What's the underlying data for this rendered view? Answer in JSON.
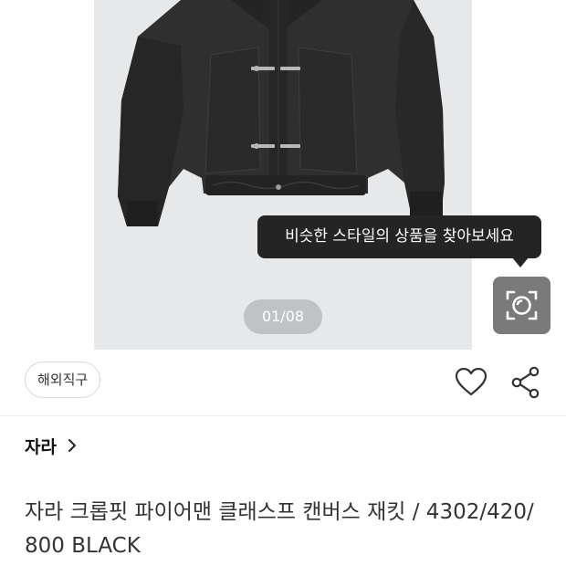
{
  "gallery": {
    "counter": "01/08",
    "visual_search_tooltip": "비슷한 스타일의 상품을 찾아보세요"
  },
  "product": {
    "badge": "해외직구",
    "brand": "자라",
    "title": "자라 크롭핏 파이어맨 클래스프 캔버스 재킷 / 4302/420/800 BLACK"
  },
  "colors": {
    "photo_bg": "#e6e8ea",
    "tooltip_bg": "#242424",
    "lens_button_bg": "#7a7a7a"
  },
  "icons": {
    "lens": "camera-lens-icon",
    "favorite": "heart-icon",
    "share": "share-icon",
    "brand_link": "chevron-right-icon"
  }
}
